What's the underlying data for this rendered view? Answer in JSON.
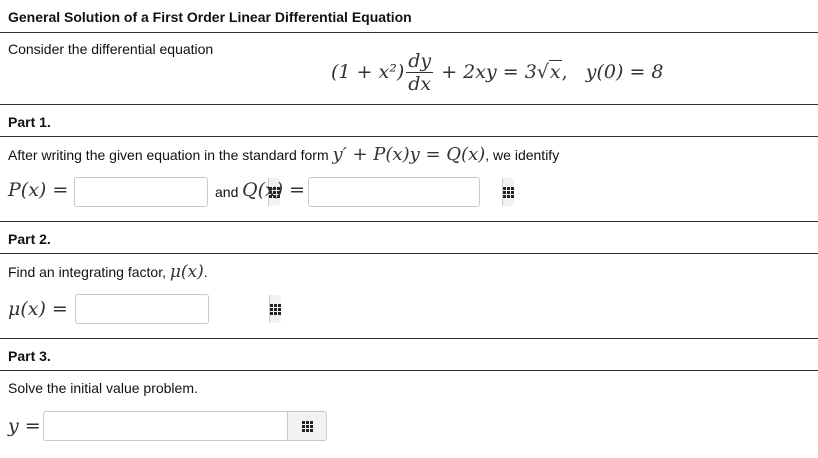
{
  "title": "General Solution of a First Order Linear Differential Equation",
  "intro": "Consider the differential equation",
  "equation": {
    "lhs_prefix": "(1 + x²)",
    "frac_num": "dy",
    "frac_den": "dx",
    "middle": " + 2xy = 3",
    "sqrt_arg": "x",
    "condition": "y(0) = 8"
  },
  "part1": {
    "heading": "Part 1.",
    "text_before": "After writing the given equation in the standard form ",
    "standard_form": "y′ + P(x)y = Q(x)",
    "text_after": ", we identify",
    "p_label": "P(x) =",
    "and_text": "and",
    "q_label": "Q(x) =",
    "p_value": "",
    "q_value": ""
  },
  "part2": {
    "heading": "Part 2.",
    "text": "Find an integrating factor, ",
    "mu": "μ(x)",
    "period": ".",
    "mu_label": "μ(x) =",
    "mu_value": ""
  },
  "part3": {
    "heading": "Part 3.",
    "text": "Solve the initial value problem.",
    "y_label": "y =",
    "y_value": ""
  },
  "icons": {
    "keypad": "keypad-grid-icon"
  }
}
